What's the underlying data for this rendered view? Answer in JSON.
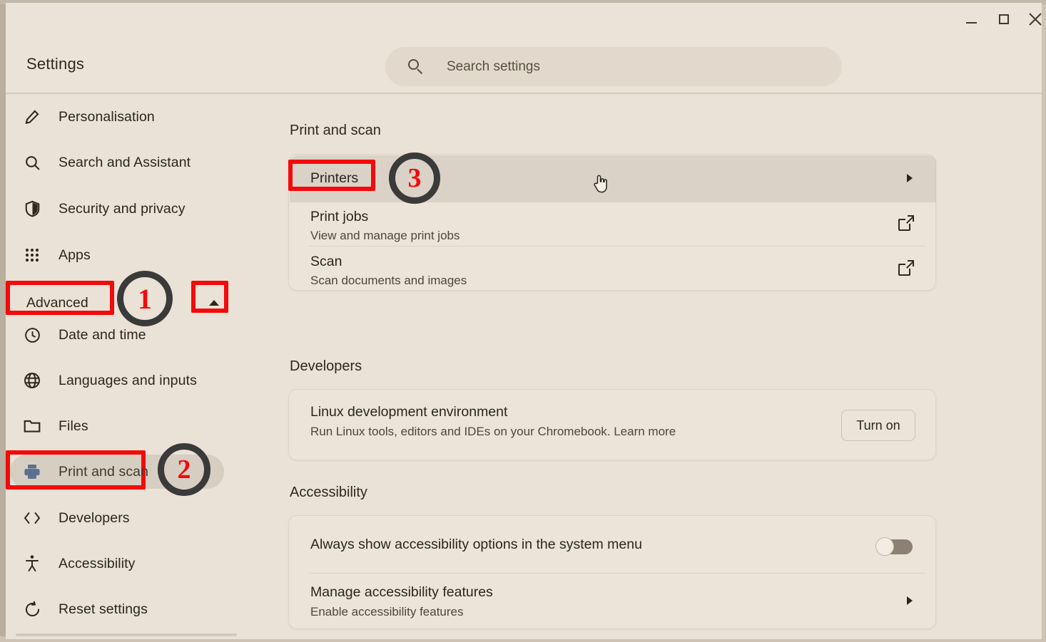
{
  "window": {
    "controls": [
      {
        "name": "minimize",
        "glyph": "–"
      },
      {
        "name": "maximize",
        "glyph": "□"
      },
      {
        "name": "close",
        "glyph": "×"
      }
    ]
  },
  "header": {
    "title": "Settings"
  },
  "search": {
    "placeholder": "Search settings",
    "icon": "search-icon"
  },
  "sidebar": {
    "items": [
      {
        "label": "Personalisation",
        "icon": "pen-icon",
        "selected": false
      },
      {
        "label": "Search and Assistant",
        "icon": "search-icon",
        "selected": false
      },
      {
        "label": "Security and privacy",
        "icon": "shield-icon",
        "selected": false
      },
      {
        "label": "Apps",
        "icon": "apps-grid-icon",
        "selected": false
      }
    ],
    "advanced": {
      "label": "Advanced",
      "expanded": true,
      "icon": "chevron-up-icon"
    },
    "advanced_items": [
      {
        "label": "Date and time",
        "icon": "clock-icon",
        "selected": false
      },
      {
        "label": "Languages and inputs",
        "icon": "globe-icon",
        "selected": false
      },
      {
        "label": "Files",
        "icon": "folder-icon",
        "selected": false
      },
      {
        "label": "Print and scan",
        "icon": "printer-icon",
        "selected": true
      },
      {
        "label": "Developers",
        "icon": "code-brackets-icon",
        "selected": false
      },
      {
        "label": "Accessibility",
        "icon": "accessibility-icon",
        "selected": false
      },
      {
        "label": "Reset settings",
        "icon": "reset-icon",
        "selected": false
      }
    ]
  },
  "main": {
    "print_and_scan": {
      "section_title": "Print and scan",
      "rows": [
        {
          "title": "Printers",
          "subtitle": "",
          "action": "chevron-right-icon",
          "hovered": true
        },
        {
          "title": "Print jobs",
          "subtitle": "View and manage print jobs",
          "action": "external-link-icon",
          "hovered": false
        },
        {
          "title": "Scan",
          "subtitle": "Scan documents and images",
          "action": "external-link-icon",
          "hovered": false
        }
      ]
    },
    "developers": {
      "section_title": "Developers",
      "row": {
        "title": "Linux development environment",
        "subtitle": "Run Linux tools, editors and IDEs on your Chromebook. Learn more",
        "link_text": "Learn more",
        "button_label": "Turn on"
      }
    },
    "accessibility": {
      "section_title": "Accessibility",
      "rows": [
        {
          "title": "Always show accessibility options in the system menu",
          "subtitle": "",
          "control": "toggle-switch",
          "toggle_on": false
        },
        {
          "title": "Manage accessibility features",
          "subtitle": "Enable accessibility features",
          "control": "chevron-right-icon"
        }
      ]
    }
  },
  "annotations": {
    "step_badges": [
      {
        "number": "1",
        "target": "Advanced"
      },
      {
        "number": "2",
        "target": "Print and scan"
      },
      {
        "number": "3",
        "target": "Printers"
      }
    ],
    "highlight_color": "#f40a0a",
    "badge_ring_color": "#3a3a3a"
  },
  "cursor": {
    "type": "pointing-hand"
  }
}
